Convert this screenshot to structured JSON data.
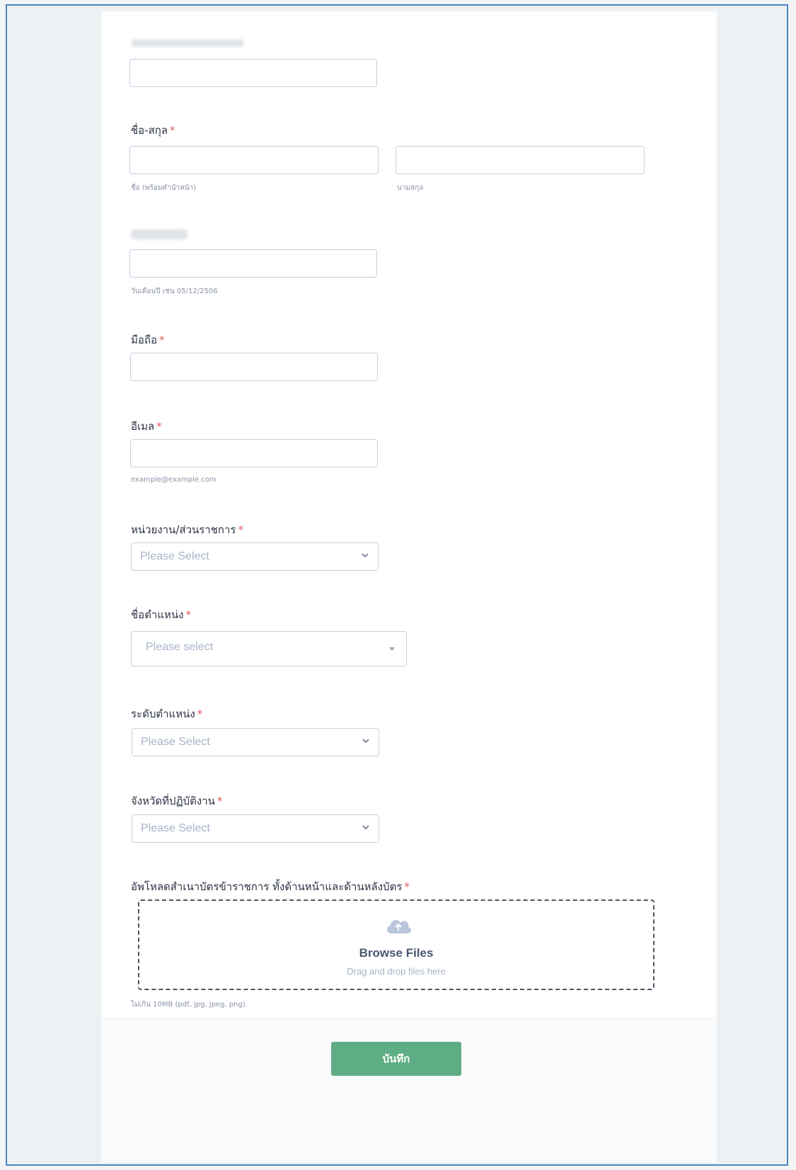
{
  "form": {
    "fields": {
      "name": {
        "label": "ชื่อ-สกุล",
        "required_mark": "*",
        "first_sublabel": "ชื่อ (พร้อมคำนำหน้า)",
        "last_sublabel": "นามสกุล"
      },
      "birthdate": {
        "sublabel": "วันเดือนปี เช่น 05/12/2506"
      },
      "mobile": {
        "label": "มือถือ",
        "required_mark": "*"
      },
      "email": {
        "label": "อีเมล",
        "required_mark": "*",
        "sublabel": "example@example.com"
      },
      "department": {
        "label": "หน่วยงาน/ส่วนราชการ",
        "required_mark": "*",
        "placeholder": "Please Select"
      },
      "position": {
        "label": "ชื่อตำแหน่ง",
        "required_mark": "*",
        "placeholder": "Please select"
      },
      "level": {
        "label": "ระดับตำแหน่ง",
        "required_mark": "*",
        "placeholder": "Please Select"
      },
      "province": {
        "label": "จังหวัดที่ปฏิบัติงาน",
        "required_mark": "*",
        "placeholder": "Please Select"
      },
      "upload": {
        "label": "อัพโหลดสำเนาบัตรข้าราชการ ทั้งด้านหน้าและด้านหลังบัตร",
        "required_mark": "*",
        "browse_label": "Browse Files",
        "drag_hint": "Drag and drop files here",
        "icon": "cloud-upload-icon",
        "sublabel": "ไม่เกิน 10MB (pdf, jpg, jpeg, png)"
      }
    },
    "submit_label": "บันทึก"
  },
  "colors": {
    "accent_green": "#5fad84",
    "required_red": "#e15a5a",
    "frame_blue": "#4a86c8"
  }
}
